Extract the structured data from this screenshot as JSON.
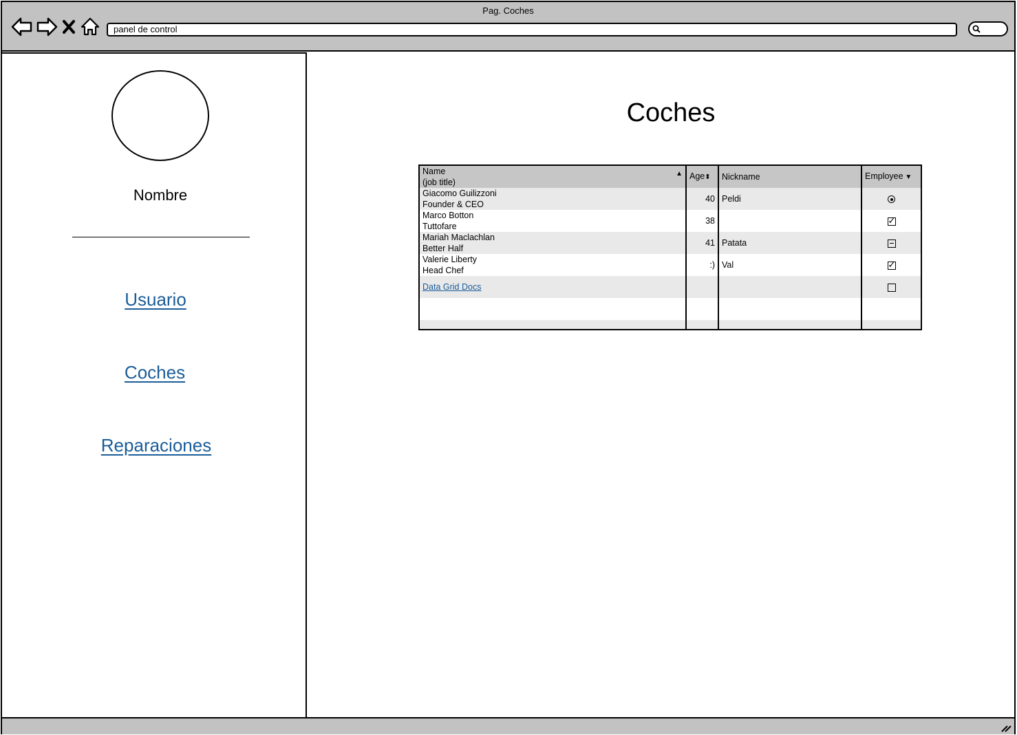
{
  "window": {
    "title": "Pag. Coches",
    "address": "panel de control"
  },
  "icons": {
    "back": "back-arrow-icon",
    "forward": "forward-arrow-icon",
    "stop": "close-icon",
    "home": "home-icon",
    "search": "search-icon"
  },
  "sidebar": {
    "user_name": "Nombre",
    "links": [
      {
        "label": "Usuario"
      },
      {
        "label": "Coches"
      },
      {
        "label": "Reparaciones"
      }
    ]
  },
  "main": {
    "title": "Coches"
  },
  "grid": {
    "headers": {
      "name": "Name",
      "name_sub": "(job title)",
      "age": "Age",
      "nickname": "Nickname",
      "employee": "Employee"
    },
    "rows": [
      {
        "name": "Giacomo Guilizzoni",
        "title": "Founder & CEO",
        "age": "40",
        "nickname": "Peldi",
        "employee": "radio"
      },
      {
        "name": "Marco Botton",
        "title": "Tuttofare",
        "age": "38",
        "nickname": "",
        "employee": "checked"
      },
      {
        "name": "Mariah Maclachlan",
        "title": "Better Half",
        "age": "41",
        "nickname": "Patata",
        "employee": "mixed"
      },
      {
        "name": "Valerie Liberty",
        "title": "Head Chef",
        "age": ":)",
        "nickname": "Val",
        "employee": "checked"
      }
    ],
    "docs_link": "Data Grid Docs"
  },
  "colors": {
    "chrome": "#c2c2c2",
    "link": "#1a5c99",
    "header_bg": "#c6c6c6",
    "alt_row": "#e9e9e9"
  }
}
